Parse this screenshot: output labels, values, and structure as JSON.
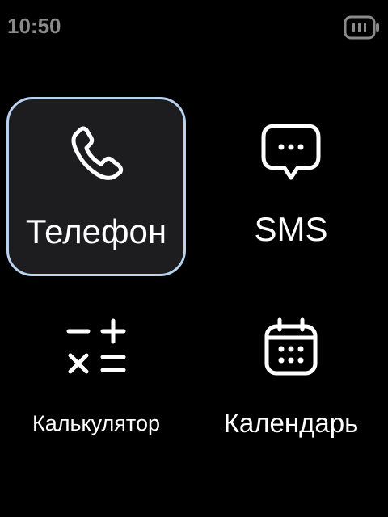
{
  "status_bar": {
    "time": "10:50",
    "battery_icon": "battery-icon"
  },
  "apps": [
    {
      "label": "Телефон",
      "icon": "phone-icon",
      "focused": true
    },
    {
      "label": "SMS",
      "icon": "message-icon",
      "focused": false
    },
    {
      "label": "Калькулятор",
      "icon": "calculator-icon",
      "focused": false
    },
    {
      "label": "Календарь",
      "icon": "calendar-icon",
      "focused": false
    }
  ],
  "colors": {
    "background": "#000000",
    "focus_border": "#b7d3ef",
    "focus_fill": "#1d1d1f",
    "status_text": "#8a8a8a",
    "label_text": "#ffffff"
  }
}
